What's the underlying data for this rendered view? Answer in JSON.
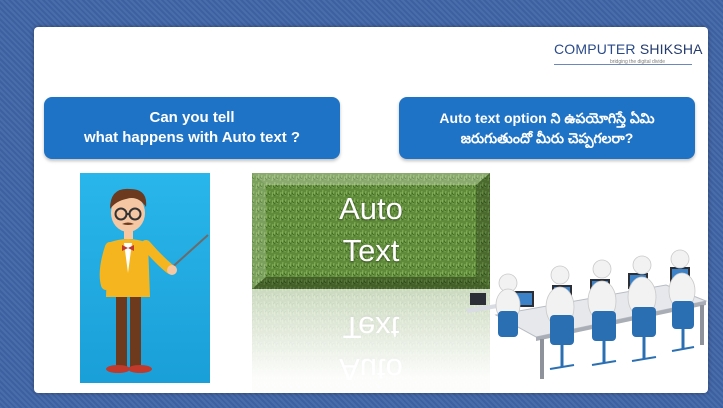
{
  "logo": {
    "brand_part1": "COMPUTER",
    "brand_part2": "SHIKSHA",
    "tagline": "bridging the digital divide"
  },
  "question_en": {
    "line1": "Can you tell",
    "line2": "what happens with Auto text ?"
  },
  "question_te": {
    "line1": "Auto text option ని ఉపయోగిస్తే ఏమి",
    "line2": "జరుగుతుందో మీరు చెప్పగలరా?"
  },
  "tile": {
    "line1": "Auto",
    "line2": "Text"
  },
  "colors": {
    "background": "#3f64a6",
    "callout": "#1f73c6",
    "teacher_panel": "#29b6ea",
    "grass": "#5f8a3a",
    "chair": "#2b6fb3"
  },
  "icons": [
    "teacher-illustration",
    "grass-tile",
    "computer-lab-illustration"
  ]
}
